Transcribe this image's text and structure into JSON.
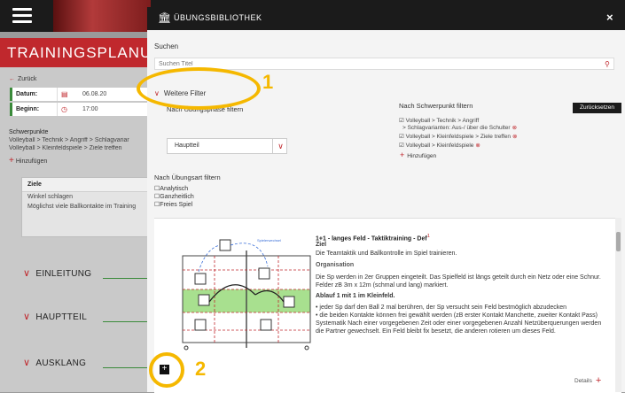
{
  "app": {
    "banner": "TRAININGSPLANUNG",
    "back": "Zurück",
    "datum_label": "Datum:",
    "datum_value": "06.08.20",
    "beginn_label": "Beginn:",
    "beginn_value": "17:00",
    "schwerpunkte_title": "Schwerpunkte",
    "schwerpunkte": [
      "Volleyball > Technik > Angriff > Schlagvariar",
      "Volleyball > Kleinfeldspiele > Ziele treffen"
    ],
    "add": "Hinzufügen",
    "ziele": {
      "header": "Ziele",
      "items": [
        "Winkel schlagen",
        "Möglichst viele Ballkontakte im Training"
      ]
    },
    "sections": [
      "EINLEITUNG",
      "HAUPTTEIL",
      "AUSKLANG"
    ]
  },
  "modal": {
    "title": "ÜBUNGSBIBLIOTHEK",
    "close": "×",
    "search_label": "Suchen",
    "search_placeholder": "Suchen Titel",
    "weitere_filter": "Weitere Filter",
    "reset": "Zurücksetzen",
    "phase_filter_title": "Nach Übungsphase filtern",
    "phase_selected": "Hauptteil",
    "schwerpunkt_filter_title": "Nach Schwerpunkt filtern",
    "schwerpunkt_items": [
      "☑ Volleyball > Technik > Angriff",
      "> Schlagvarianten: Aus-/ über die Schulter",
      "☑ Volleyball > Kleinfeldspiele > Ziele treffen",
      "☑ Volleyball > Kleinfeldspiele"
    ],
    "schwerpunkt_add": "Hinzufügen",
    "uebungsart_title": "Nach Übungsart filtern",
    "uebungsart": [
      "☐Analytisch",
      "☐Ganzheitlich",
      "☐Freies Spiel"
    ],
    "card": {
      "title": "1+1 - langes Feld - Taktiktraining - Def",
      "sup": "1",
      "ziel_head": "Ziel",
      "ziel": "Die Teamtaktik und Ballkontrolle im Spiel trainieren.",
      "org_head": "Organisation",
      "org": "Die Sp werden in 2er Gruppen eingeteilt. Das Spielfeld ist längs geteilt durch ein Netz oder eine Schnur. Felder zB 3m x 12m (schmal und lang) markiert.",
      "ablauf_head": "Ablauf 1 mit 1 im Kleinfeld.",
      "bullets": [
        "• jeder Sp darf den Ball 2 mal berühren, der Sp versucht sein Feld bestmöglich abzudecken",
        "• die beiden Kontakte können frei gewählt werden (zB erster Kontakt Manchette, zweiter Kontakt Pass) Systematik Nach einer vorgegebenen Zeit oder einer vorgegebenen Anzahl Netzüberquerungen werden die Partner gewechselt. Ein Feld bleibt fix besetzt, die anderen rotieren um dieses Feld."
      ],
      "details": "Details",
      "diagram_labels": [
        "Spielerwechsel"
      ]
    }
  },
  "annotations": {
    "one": "1",
    "two": "2"
  },
  "colors": {
    "brand_red": "#c0282d",
    "dark": "#1b1b1b",
    "annotation": "#f5b800",
    "field_green": "#a8e08f"
  }
}
